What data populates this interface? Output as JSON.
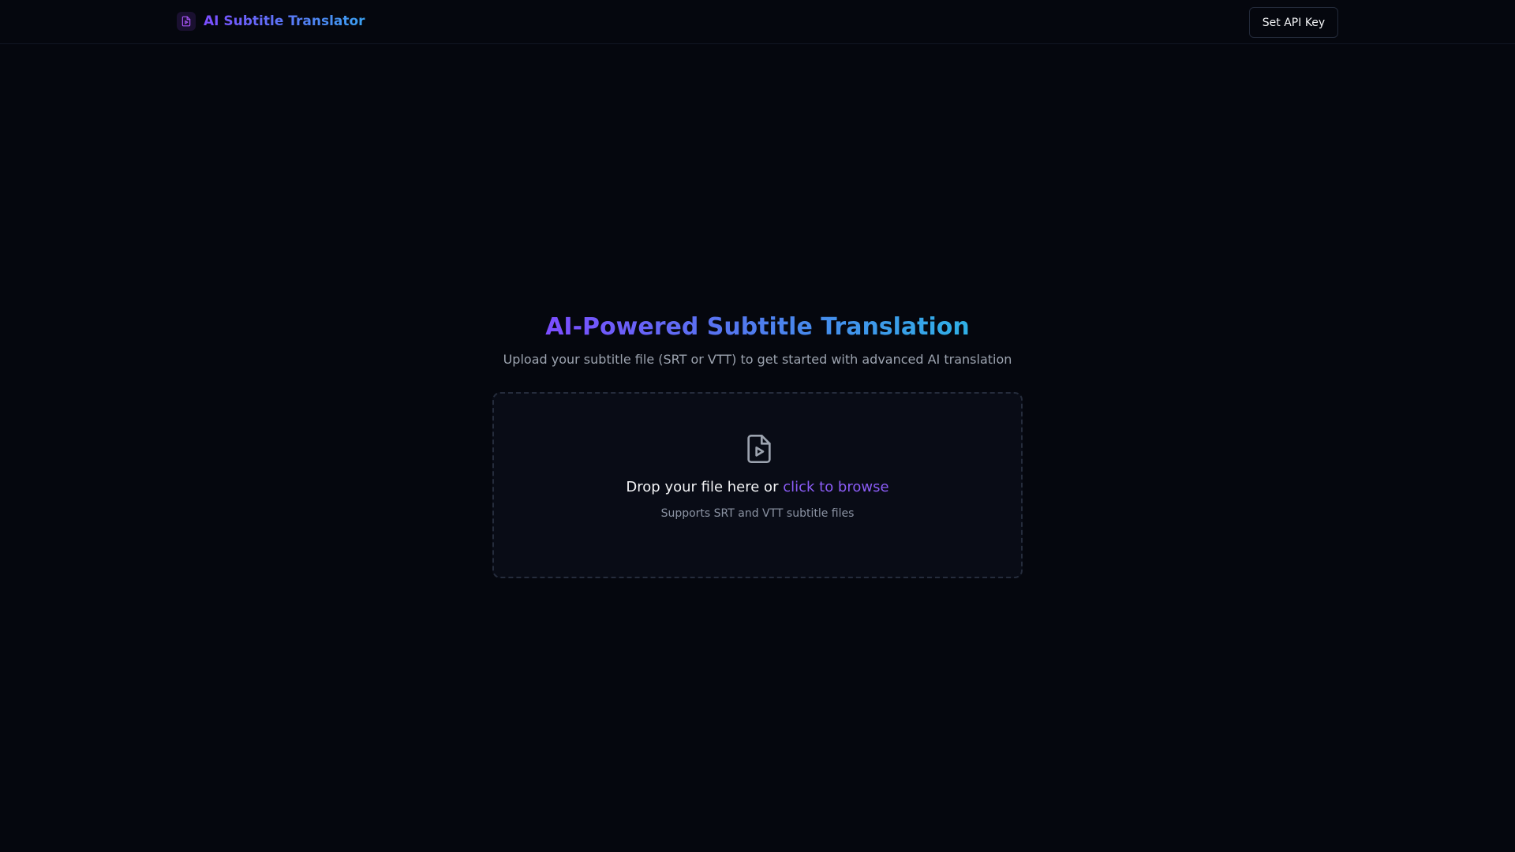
{
  "header": {
    "app_title": "AI Subtitle Translator",
    "logo_icon": "file-play-icon",
    "api_key_button": "Set API Key"
  },
  "hero": {
    "title": "AI-Powered Subtitle Translation",
    "subtitle": "Upload your subtitle file (SRT or VTT) to get started with advanced AI translation"
  },
  "dropzone": {
    "icon": "file-play-icon",
    "prompt_text": "Drop your file here or ",
    "browse_link": "click to browse",
    "hint": "Supports SRT and VTT subtitle files"
  },
  "colors": {
    "background": "#05070e",
    "accent_purple": "#7c4dff",
    "accent_blue": "#2fb0e6",
    "link": "#8b5cf6"
  }
}
